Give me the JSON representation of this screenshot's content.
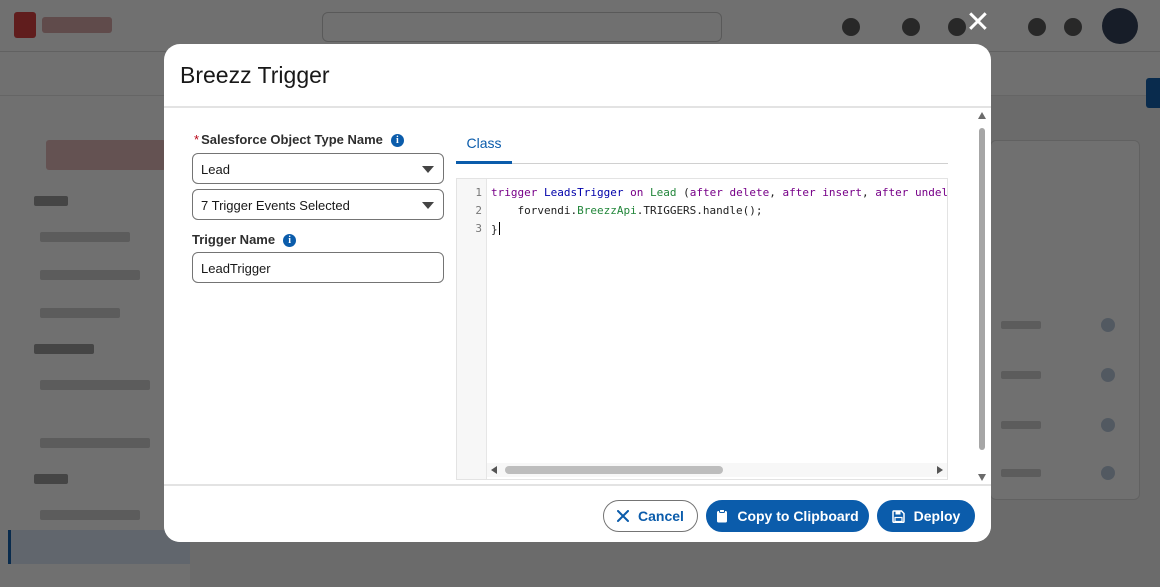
{
  "modal": {
    "title": "Breezz Trigger",
    "close_icon": "close-icon"
  },
  "form": {
    "object_type": {
      "required_marker": "*",
      "label": "Salesforce Object Type Name",
      "value": "Lead"
    },
    "trigger_events": {
      "value": "7 Trigger Events Selected"
    },
    "trigger_name": {
      "label": "Trigger Name",
      "value": "LeadTrigger"
    },
    "info_icon_glyph": "i"
  },
  "tabs": [
    {
      "label": "Class",
      "active": true
    }
  ],
  "editor": {
    "line_numbers": [
      "1",
      "2",
      "3"
    ],
    "lines": [
      [
        {
          "t": "trigger",
          "c": "kw"
        },
        {
          "t": " ",
          "c": ""
        },
        {
          "t": "LeadsTrigger",
          "c": "ty"
        },
        {
          "t": " ",
          "c": ""
        },
        {
          "t": "on",
          "c": "kw"
        },
        {
          "t": " ",
          "c": ""
        },
        {
          "t": "Lead",
          "c": "gr"
        },
        {
          "t": " (",
          "c": ""
        },
        {
          "t": "after",
          "c": "kw"
        },
        {
          "t": " ",
          "c": ""
        },
        {
          "t": "delete",
          "c": "kw"
        },
        {
          "t": ", ",
          "c": ""
        },
        {
          "t": "after",
          "c": "kw"
        },
        {
          "t": " ",
          "c": ""
        },
        {
          "t": "insert",
          "c": "kw"
        },
        {
          "t": ", ",
          "c": ""
        },
        {
          "t": "after",
          "c": "kw"
        },
        {
          "t": " ",
          "c": ""
        },
        {
          "t": "undel",
          "c": "kw"
        }
      ],
      [
        {
          "t": "    forvendi.",
          "c": ""
        },
        {
          "t": "BreezzApi",
          "c": "gr"
        },
        {
          "t": ".TRIGGERS.handle();",
          "c": ""
        }
      ],
      [
        {
          "t": "}",
          "c": ""
        }
      ]
    ]
  },
  "footer": {
    "cancel_label": "Cancel",
    "copy_label": "Copy to Clipboard",
    "deploy_label": "Deploy"
  },
  "colors": {
    "brand_blue": "#0b5cab",
    "required_red": "#ba0517",
    "keyword_purple": "#770088",
    "type_blue": "#0000aa",
    "name_green": "#22863a"
  }
}
